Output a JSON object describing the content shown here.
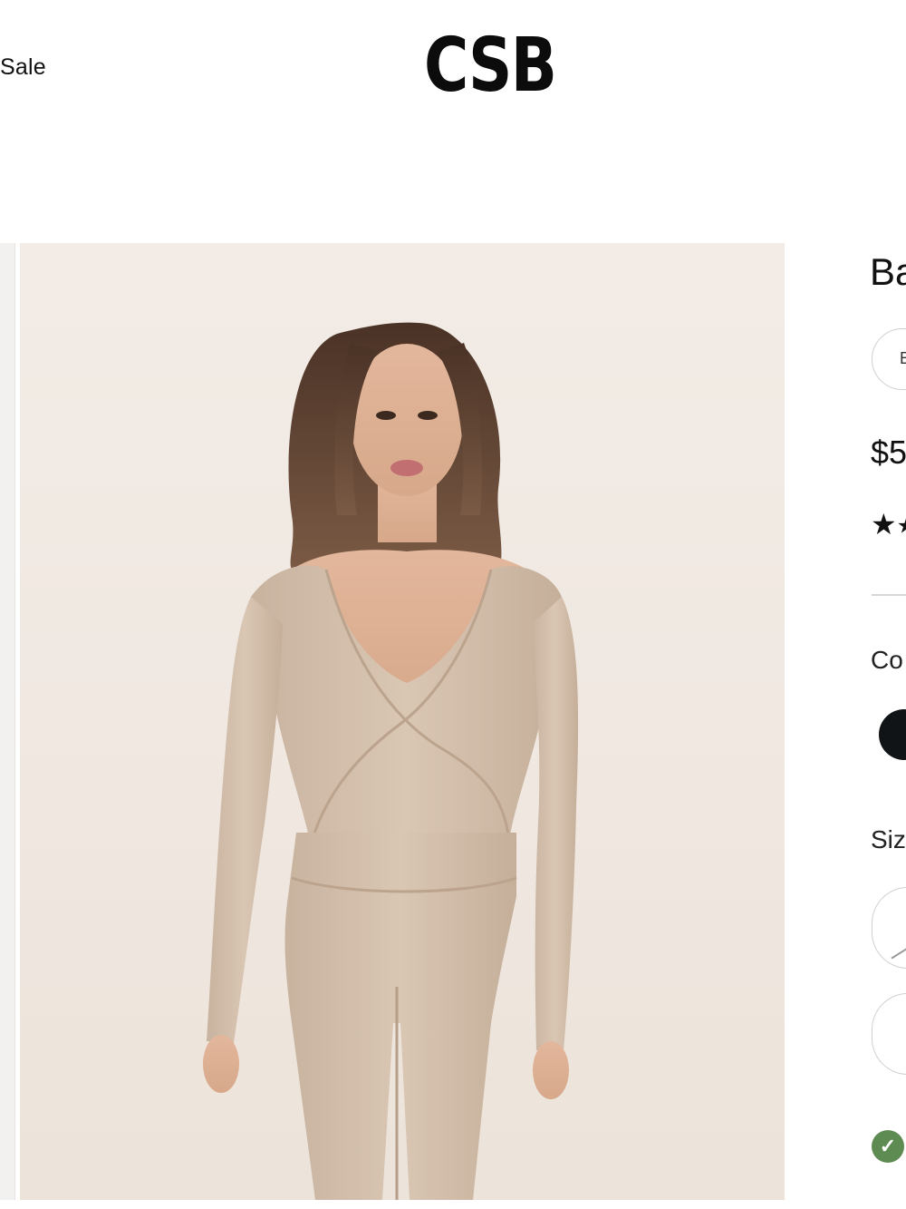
{
  "header": {
    "nav_sale": "Sale",
    "logo": "CSB"
  },
  "product": {
    "image_alt": "Model wearing beige long sleeve wrap top and leggings",
    "title_fragment": "Ba",
    "variant_chip_fragment": "B",
    "price_fragment": "$5",
    "rating_icon": "star-icon",
    "color_label_fragment": "Co",
    "size_label_fragment": "Siz",
    "selected_color_swatch": "#101416",
    "stock_icon": "check-circle-icon"
  },
  "colors": {
    "background": "#ffffff",
    "image_bg": "#f0e9e2",
    "garment": "#d6c3b0",
    "stock_green": "#5e8b52"
  }
}
